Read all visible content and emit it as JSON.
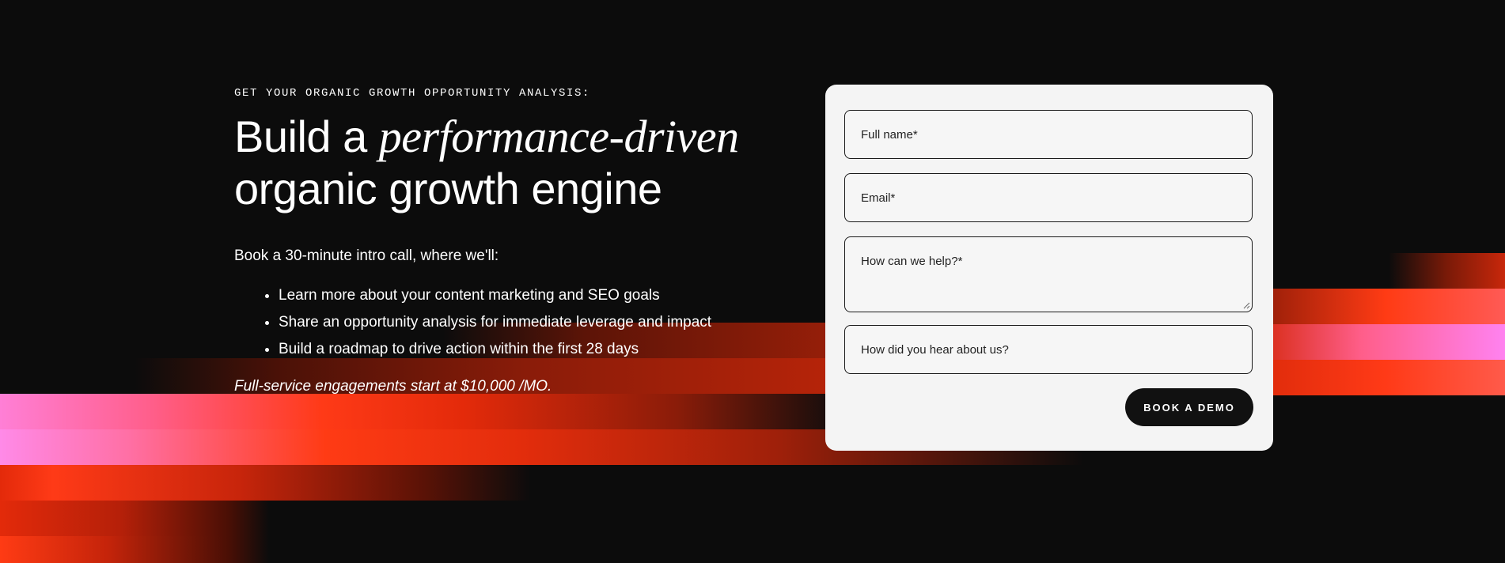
{
  "hero": {
    "eyebrow": "GET YOUR ORGANIC GROWTH OPPORTUNITY ANALYSIS:",
    "headline_part1": "Build a ",
    "headline_italic": "performance-driven",
    "headline_line2": "organic growth engine",
    "intro": "Book a 30-minute intro call, where we'll:",
    "bullets": [
      "Learn more about your content marketing and SEO goals",
      "Share an opportunity analysis for immediate leverage and impact",
      "Build a roadmap to drive action within the first 28 days"
    ],
    "pricing": "Full-service engagements start at $10,000 /MO."
  },
  "form": {
    "full_name_placeholder": "Full name*",
    "email_placeholder": "Email*",
    "help_placeholder": "How can we help?*",
    "referral_placeholder": "How did you hear about us?",
    "submit_label": "BOOK A DEMO"
  },
  "colors": {
    "background": "#0c0c0c",
    "card": "#f4f4f4",
    "button": "#111111",
    "accent_red": "#ff3a17",
    "accent_pink": "#ff82f0"
  }
}
